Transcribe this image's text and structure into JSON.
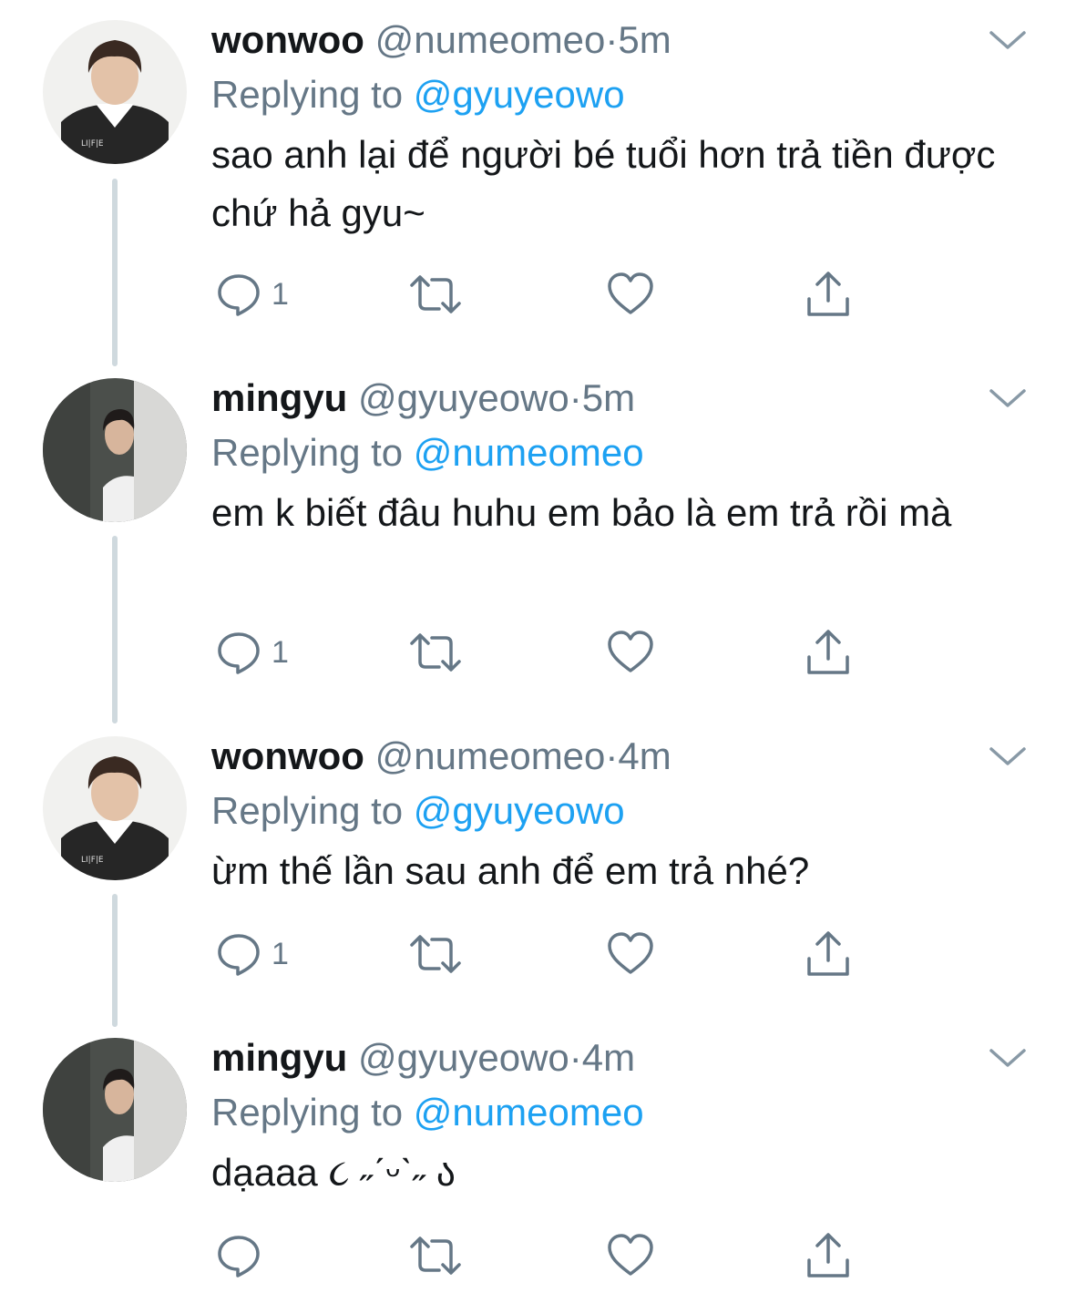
{
  "tweets": [
    {
      "name": "wonwoo",
      "handle": "@numeomeo",
      "separator": "·",
      "time": "5m",
      "replying_prefix": "Replying to",
      "replying_to": "@gyuyeowo",
      "text": "sao anh lại để người bé tuổi hơn trả tiền được chứ hả gyu~",
      "reply_count": "1",
      "avatar": "wonwoo-avatar"
    },
    {
      "name": "mingyu",
      "handle": "@gyuyeowo",
      "separator": "·",
      "time": "5m",
      "replying_prefix": "Replying to",
      "replying_to": "@numeomeo",
      "text": "em k biết đâu huhu em bảo là em trả rồi mà",
      "reply_count": "1",
      "avatar": "mingyu-avatar"
    },
    {
      "name": "wonwoo",
      "handle": "@numeomeo",
      "separator": "·",
      "time": "4m",
      "replying_prefix": "Replying to",
      "replying_to": "@gyuyeowo",
      "text": "ừm thế lần sau anh để em trả nhé?",
      "reply_count": "1",
      "avatar": "wonwoo-avatar"
    },
    {
      "name": "mingyu",
      "handle": "@gyuyeowo",
      "separator": "·",
      "time": "4m",
      "replying_prefix": "Replying to",
      "replying_to": "@numeomeo",
      "text": "dạaaa ૮ ˶ˊᵕˋ˶ ა",
      "reply_count": "",
      "avatar": "mingyu-avatar"
    }
  ],
  "icons": {
    "reply": "reply-icon",
    "retweet": "retweet-icon",
    "like": "heart-icon",
    "share": "share-icon",
    "more": "chevron-down-icon"
  },
  "colors": {
    "link": "#1da1f2",
    "meta": "#657786",
    "text": "#14171a",
    "thread_line": "#cfd9de"
  }
}
